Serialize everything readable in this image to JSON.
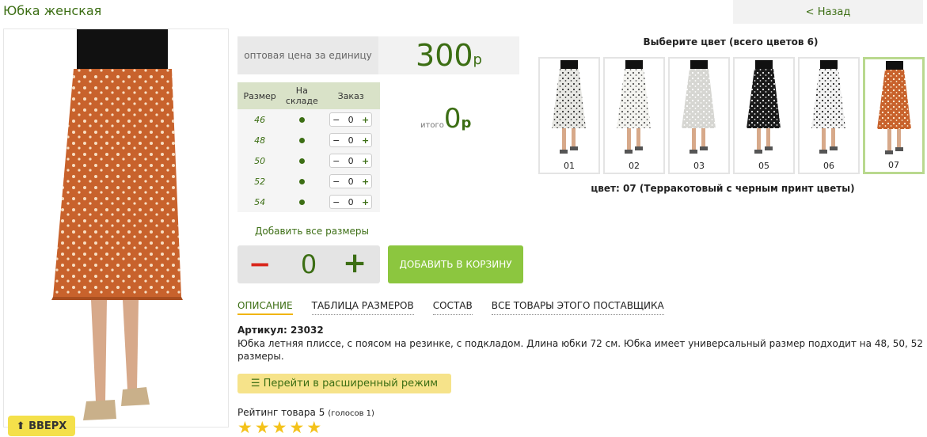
{
  "page_title": "Юбка женская",
  "back_link": "< Назад",
  "scroll_top_button": "⬆ ВВЕРХ",
  "price": {
    "label": "оптовая цена за единицу",
    "value": "300",
    "currency": "р"
  },
  "size_table": {
    "headers": [
      "Размер",
      "На складе",
      "Заказ"
    ],
    "rows": [
      {
        "size": "46",
        "qty": "0"
      },
      {
        "size": "48",
        "qty": "0"
      },
      {
        "size": "50",
        "qty": "0"
      },
      {
        "size": "52",
        "qty": "0"
      },
      {
        "size": "54",
        "qty": "0"
      }
    ],
    "minus": "−",
    "plus": "+"
  },
  "total": {
    "label": "итого",
    "value": "0",
    "currency": "р"
  },
  "add_all_sizes": "Добавить все размеры",
  "quantity": {
    "minus": "−",
    "value": "0",
    "plus": "+"
  },
  "add_to_cart": "ДОБАВИТЬ В КОРЗИНУ",
  "tabs": [
    "ОПИСАНИЕ",
    "ТАБЛИЦА РАЗМЕРОВ",
    "СОСТАВ",
    "ВСЕ ТОВАРЫ ЭТОГО ПОСТАВЩИКА"
  ],
  "article": "Артикул: 23032",
  "description": "Юбка летняя плиссе, с поясом на резинке, с подкладом. Длина юбки 72 см. Юбка имеет универсальный размер подходит на 48, 50, 52 размеры.",
  "extended_mode_button": "☰ Перейти в расширенный режим",
  "rating": {
    "label": "Рейтинг товара 5",
    "votes": "(голосов 1)",
    "stars": 5
  },
  "colors": {
    "title": "Выберите цвет (всего цветов 6)",
    "items": [
      {
        "code": "01",
        "fabric": "#e8e8e4",
        "print": "#333333"
      },
      {
        "code": "02",
        "fabric": "#f4f4f0",
        "print": "#555555"
      },
      {
        "code": "03",
        "fabric": "#d6d6d2",
        "print": "#ffffff"
      },
      {
        "code": "05",
        "fabric": "#1a1a1a",
        "print": "#f0f0f0"
      },
      {
        "code": "06",
        "fabric": "#f2f2f2",
        "print": "#222222"
      },
      {
        "code": "07",
        "fabric": "#c8622c",
        "print": "#fff4dc"
      }
    ],
    "selected_text": "цвет: 07 (Терракотовый с черным принт цветы)"
  },
  "accent_colors": {
    "green": "#3c6e14",
    "button_green": "#8cc63f",
    "minus_red": "#d9261c",
    "star": "#f4c21a"
  }
}
